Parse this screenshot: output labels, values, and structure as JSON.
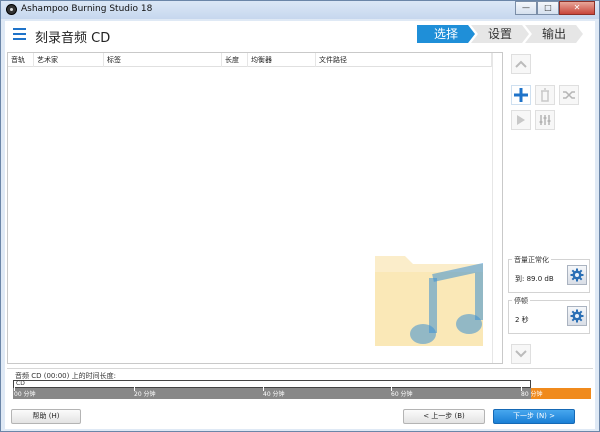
{
  "window": {
    "title": "Ashampoo Burning Studio 18",
    "buttons": {
      "minimize": "—",
      "maximize": "□",
      "close": "✕"
    }
  },
  "header": {
    "menu_icon": "hamburger-icon",
    "title": "刻录音频 CD",
    "steps": [
      {
        "label": "选择",
        "active": true
      },
      {
        "label": "设置",
        "active": false
      },
      {
        "label": "输出",
        "active": false
      }
    ]
  },
  "track_list": {
    "columns": [
      "音轨",
      "艺术家",
      "标签",
      "长度",
      "均衡器",
      "文件路径"
    ],
    "rows": []
  },
  "tools": {
    "icons": [
      "chevron-up-icon",
      "add-icon",
      "delete-icon",
      "shuffle-icon",
      "play-icon",
      "equalizer-icon",
      "chevron-down-icon"
    ]
  },
  "normalize": {
    "label": "音量正常化",
    "value": "到: 89.0 dB"
  },
  "pause": {
    "label": "停顿",
    "value": "2 秒"
  },
  "capacity": {
    "label": "音频 CD (00:00) 上的时间长度:",
    "disc": "CD",
    "ticks": [
      "00 分钟",
      "20 分钟",
      "40 分钟",
      "60 分钟",
      "80 分钟"
    ],
    "colors": {
      "used": "#888888",
      "overflow": "#f08a1c"
    }
  },
  "footer": {
    "help": "帮助 (H)",
    "back": "< 上一步 (B)",
    "next": "下一步 (N) >"
  },
  "colors": {
    "accent": "#1f8fd8",
    "step_inactive": "#e6e6e6"
  }
}
